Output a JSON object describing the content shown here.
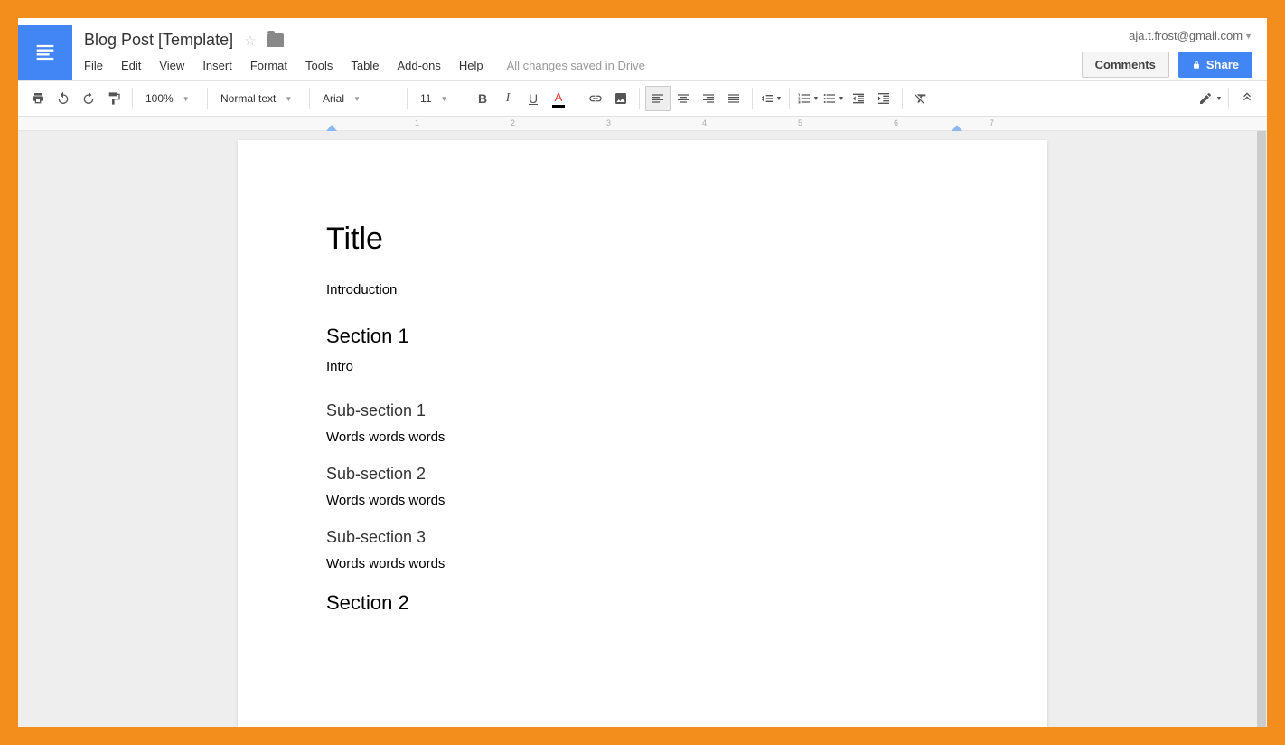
{
  "header": {
    "title": "Blog Post [Template]",
    "user_email": "aja.t.frost@gmail.com",
    "comments_button": "Comments",
    "share_button": "Share",
    "menu": [
      "File",
      "Edit",
      "View",
      "Insert",
      "Format",
      "Tools",
      "Table",
      "Add-ons",
      "Help"
    ],
    "save_status": "All changes saved in Drive"
  },
  "toolbar": {
    "zoom": "100%",
    "style": "Normal text",
    "font": "Arial",
    "font_size": "11"
  },
  "ruler": {
    "marks": [
      "1",
      "2",
      "3",
      "4",
      "5",
      "6",
      "7"
    ]
  },
  "document": {
    "title": "Title",
    "intro": "Introduction",
    "section1": "Section 1",
    "section1_intro": "Intro",
    "sub1": "Sub-section 1",
    "sub1_body": "Words words words",
    "sub2": "Sub-section 2",
    "sub2_body": "Words words words",
    "sub3": "Sub-section 3",
    "sub3_body": "Words words words",
    "section2": "Section 2"
  }
}
